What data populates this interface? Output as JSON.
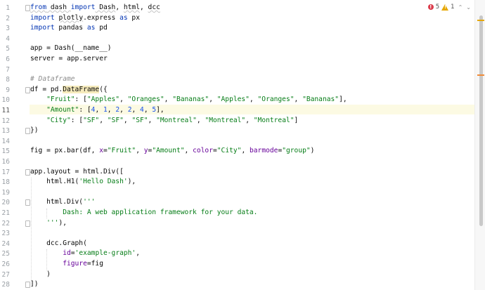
{
  "inspections": {
    "errors": "5",
    "warnings": "1",
    "colors": {
      "error": "#db3b4b",
      "warning": "#e6a700"
    }
  },
  "line_numbers": [
    "1",
    "2",
    "3",
    "4",
    "5",
    "6",
    "7",
    "8",
    "9",
    "10",
    "11",
    "12",
    "13",
    "14",
    "15",
    "16",
    "17",
    "18",
    "19",
    "20",
    "21",
    "22",
    "23",
    "24",
    "25",
    "26",
    "27",
    "28"
  ],
  "current_line": "11",
  "colors": {
    "keyword": "#0033b3",
    "string": "#067d17",
    "number": "#1750eb",
    "comment": "#8c8c8c",
    "param": "#660099",
    "current_line_bg": "#fcfae3"
  },
  "code": {
    "l1": {
      "t1": "from",
      "t2": " dash ",
      "t3": "import",
      "t4": " Dash",
      "t5": ", ",
      "t6": "html",
      "t7": ", ",
      "t8": "dcc"
    },
    "l2": {
      "t1": "import",
      "t2": " ",
      "t3": "plotly",
      "t4": ".express ",
      "t5": "as",
      "t6": " px"
    },
    "l3": {
      "t1": "import",
      "t2": " pandas ",
      "t3": "as",
      "t4": " pd"
    },
    "l4": {},
    "l5": {
      "t1": "app = Dash(__name__)"
    },
    "l6": {
      "t1": "server = app.server"
    },
    "l7": {},
    "l8": {
      "t1": "# Dataframe"
    },
    "l9": {
      "t1": "df = pd.",
      "t2": "DataFrame",
      "t3": "({"
    },
    "l10": {
      "t1": "    ",
      "t2": "\"Fruit\"",
      "t3": ": [",
      "t4": "\"Apples\"",
      "t5": ", ",
      "t6": "\"Oranges\"",
      "t7": ", ",
      "t8": "\"Bananas\"",
      "t9": ", ",
      "t10": "\"Apples\"",
      "t11": ", ",
      "t12": "\"Oranges\"",
      "t13": ", ",
      "t14": "\"Bananas\"",
      "t15": "],"
    },
    "l11": {
      "t1": "    ",
      "t2": "\"Amount\"",
      "t3": ": [",
      "t4": "4",
      "t5": ", ",
      "t6": "1",
      "t7": ", ",
      "t8": "2",
      "t9": ", ",
      "t10": "2",
      "t11": ", ",
      "t12": "4",
      "t13": ", ",
      "t14": "5",
      "t15": "],"
    },
    "l12": {
      "t1": "    ",
      "t2": "\"City\"",
      "t3": ": [",
      "t4": "\"SF\"",
      "t5": ", ",
      "t6": "\"SF\"",
      "t7": ", ",
      "t8": "\"SF\"",
      "t9": ", ",
      "t10": "\"Montreal\"",
      "t11": ", ",
      "t12": "\"Montreal\"",
      "t13": ", ",
      "t14": "\"Montreal\"",
      "t15": "]"
    },
    "l13": {
      "t1": "})"
    },
    "l14": {},
    "l15": {
      "t1": "fig = px.bar(df, ",
      "t2": "x",
      "t3": "=",
      "t4": "\"Fruit\"",
      "t5": ", ",
      "t6": "y",
      "t7": "=",
      "t8": "\"Amount\"",
      "t9": ", ",
      "t10": "color",
      "t11": "=",
      "t12": "\"City\"",
      "t13": ", ",
      "t14": "barmode",
      "t15": "=",
      "t16": "\"group\"",
      "t17": ")"
    },
    "l16": {},
    "l17": {
      "t1": "app.layout = html.Div(["
    },
    "l18": {
      "t1": "    html.H1(",
      "t2": "'Hello Dash'",
      "t3": "),"
    },
    "l19": {},
    "l20": {
      "t1": "    html.Div(",
      "t2": "'''"
    },
    "l21": {
      "t1": "        ",
      "t2": "Dash: A web application framework for your data."
    },
    "l22": {
      "t1": "    ",
      "t2": "'''",
      "t3": "),"
    },
    "l23": {},
    "l24": {
      "t1": "    dcc.Graph("
    },
    "l25": {
      "t1": "        ",
      "t2": "id",
      "t3": "=",
      "t4": "'example-graph'",
      "t5": ","
    },
    "l26": {
      "t1": "        ",
      "t2": "figure",
      "t3": "=fig"
    },
    "l27": {
      "t1": "    )"
    },
    "l28": {
      "t1": "])"
    }
  }
}
